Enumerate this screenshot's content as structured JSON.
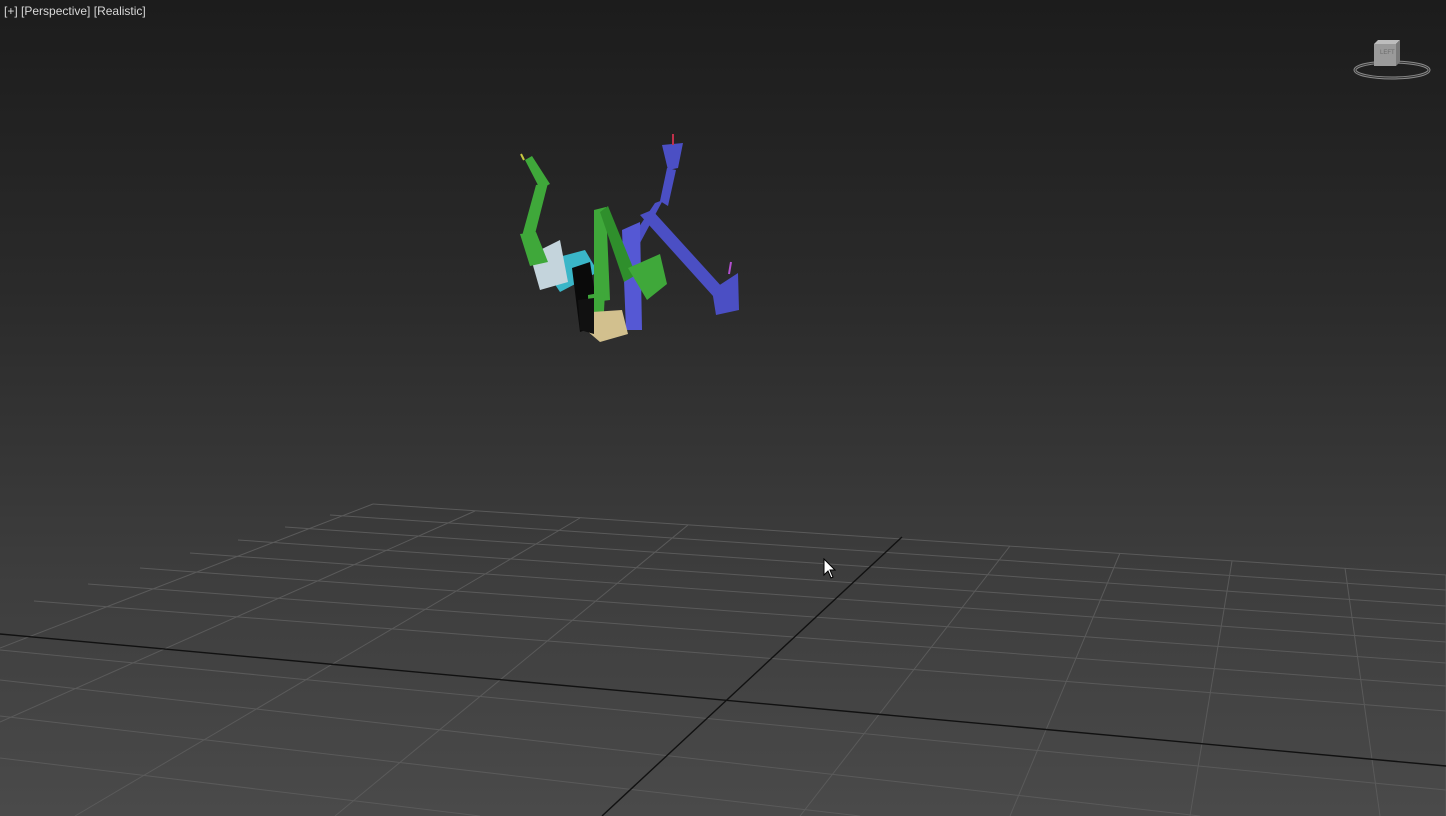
{
  "viewport": {
    "menu_label": "[+]",
    "view_label": "[Perspective]",
    "shading_label": "[Realistic]"
  },
  "viewcube": {
    "face_label": "LEFT"
  },
  "icons": {
    "viewcube": "viewcube-icon",
    "cursor": "mouse-pointer-icon"
  },
  "colors": {
    "background_top": "#1c1c1c",
    "background_bottom": "#4a4a4a",
    "grid_line": "#5a5a5a",
    "grid_axis": "#111111",
    "biped_left": "#3fa83a",
    "biped_right": "#4b4fc4",
    "biped_spine": "#3ab6c8",
    "biped_head": "#d2c08e",
    "label_text": "#d8d8d8"
  }
}
